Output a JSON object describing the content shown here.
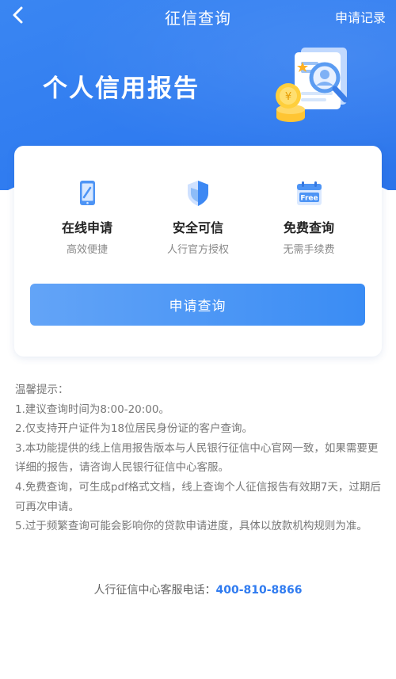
{
  "nav": {
    "title": "征信查询",
    "right_link": "申请记录"
  },
  "hero": {
    "title": "个人信用报告"
  },
  "features": [
    {
      "title": "在线申请",
      "subtitle": "高效便捷",
      "icon": "phone-edit-icon"
    },
    {
      "title": "安全可信",
      "subtitle": "人行官方授权",
      "icon": "shield-icon"
    },
    {
      "title": "免费查询",
      "subtitle": "无需手续费",
      "icon": "free-calendar-icon",
      "badge": "Free"
    }
  ],
  "apply_button": "申请查询",
  "tips": {
    "heading": "温馨提示：",
    "lines": [
      "1.建议查询时间为8:00-20:00。",
      "2.仅支持开户证件为18位居民身份证的客户查询。",
      "3.本功能提供的线上信用报告版本与人民银行征信中心官网一致，如果需要更详细的报告，请咨询人民银行征信中心客服。",
      "4.免费查询，可生成pdf格式文档，线上查询个人征信报告有效期7天，过期后可再次申请。",
      "5.过于频繁查询可能会影响你的贷款申请进度，具体以放款机构规则为准。"
    ]
  },
  "hotline": {
    "label": "人行征信中心客服电话：",
    "phone": "400-810-8866"
  },
  "colors": {
    "primary": "#2f7bf0",
    "button_start": "#63a4f7",
    "button_end": "#3a8cf4"
  }
}
